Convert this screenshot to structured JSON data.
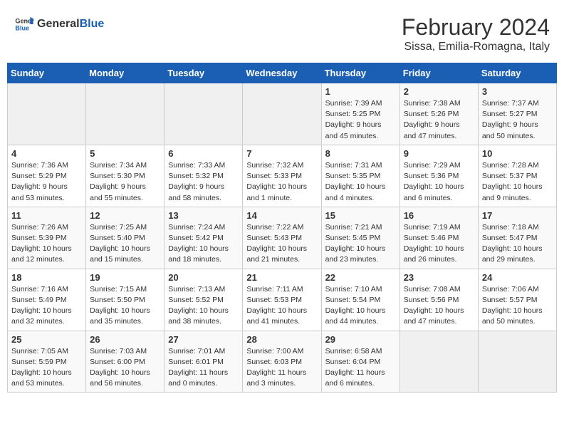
{
  "header": {
    "logo_general": "General",
    "logo_blue": "Blue",
    "title": "February 2024",
    "subtitle": "Sissa, Emilia-Romagna, Italy"
  },
  "weekdays": [
    "Sunday",
    "Monday",
    "Tuesday",
    "Wednesday",
    "Thursday",
    "Friday",
    "Saturday"
  ],
  "weeks": [
    [
      {
        "day": "",
        "info": ""
      },
      {
        "day": "",
        "info": ""
      },
      {
        "day": "",
        "info": ""
      },
      {
        "day": "",
        "info": ""
      },
      {
        "day": "1",
        "info": "Sunrise: 7:39 AM\nSunset: 5:25 PM\nDaylight: 9 hours\nand 45 minutes."
      },
      {
        "day": "2",
        "info": "Sunrise: 7:38 AM\nSunset: 5:26 PM\nDaylight: 9 hours\nand 47 minutes."
      },
      {
        "day": "3",
        "info": "Sunrise: 7:37 AM\nSunset: 5:27 PM\nDaylight: 9 hours\nand 50 minutes."
      }
    ],
    [
      {
        "day": "4",
        "info": "Sunrise: 7:36 AM\nSunset: 5:29 PM\nDaylight: 9 hours\nand 53 minutes."
      },
      {
        "day": "5",
        "info": "Sunrise: 7:34 AM\nSunset: 5:30 PM\nDaylight: 9 hours\nand 55 minutes."
      },
      {
        "day": "6",
        "info": "Sunrise: 7:33 AM\nSunset: 5:32 PM\nDaylight: 9 hours\nand 58 minutes."
      },
      {
        "day": "7",
        "info": "Sunrise: 7:32 AM\nSunset: 5:33 PM\nDaylight: 10 hours\nand 1 minute."
      },
      {
        "day": "8",
        "info": "Sunrise: 7:31 AM\nSunset: 5:35 PM\nDaylight: 10 hours\nand 4 minutes."
      },
      {
        "day": "9",
        "info": "Sunrise: 7:29 AM\nSunset: 5:36 PM\nDaylight: 10 hours\nand 6 minutes."
      },
      {
        "day": "10",
        "info": "Sunrise: 7:28 AM\nSunset: 5:37 PM\nDaylight: 10 hours\nand 9 minutes."
      }
    ],
    [
      {
        "day": "11",
        "info": "Sunrise: 7:26 AM\nSunset: 5:39 PM\nDaylight: 10 hours\nand 12 minutes."
      },
      {
        "day": "12",
        "info": "Sunrise: 7:25 AM\nSunset: 5:40 PM\nDaylight: 10 hours\nand 15 minutes."
      },
      {
        "day": "13",
        "info": "Sunrise: 7:24 AM\nSunset: 5:42 PM\nDaylight: 10 hours\nand 18 minutes."
      },
      {
        "day": "14",
        "info": "Sunrise: 7:22 AM\nSunset: 5:43 PM\nDaylight: 10 hours\nand 21 minutes."
      },
      {
        "day": "15",
        "info": "Sunrise: 7:21 AM\nSunset: 5:45 PM\nDaylight: 10 hours\nand 23 minutes."
      },
      {
        "day": "16",
        "info": "Sunrise: 7:19 AM\nSunset: 5:46 PM\nDaylight: 10 hours\nand 26 minutes."
      },
      {
        "day": "17",
        "info": "Sunrise: 7:18 AM\nSunset: 5:47 PM\nDaylight: 10 hours\nand 29 minutes."
      }
    ],
    [
      {
        "day": "18",
        "info": "Sunrise: 7:16 AM\nSunset: 5:49 PM\nDaylight: 10 hours\nand 32 minutes."
      },
      {
        "day": "19",
        "info": "Sunrise: 7:15 AM\nSunset: 5:50 PM\nDaylight: 10 hours\nand 35 minutes."
      },
      {
        "day": "20",
        "info": "Sunrise: 7:13 AM\nSunset: 5:52 PM\nDaylight: 10 hours\nand 38 minutes."
      },
      {
        "day": "21",
        "info": "Sunrise: 7:11 AM\nSunset: 5:53 PM\nDaylight: 10 hours\nand 41 minutes."
      },
      {
        "day": "22",
        "info": "Sunrise: 7:10 AM\nSunset: 5:54 PM\nDaylight: 10 hours\nand 44 minutes."
      },
      {
        "day": "23",
        "info": "Sunrise: 7:08 AM\nSunset: 5:56 PM\nDaylight: 10 hours\nand 47 minutes."
      },
      {
        "day": "24",
        "info": "Sunrise: 7:06 AM\nSunset: 5:57 PM\nDaylight: 10 hours\nand 50 minutes."
      }
    ],
    [
      {
        "day": "25",
        "info": "Sunrise: 7:05 AM\nSunset: 5:59 PM\nDaylight: 10 hours\nand 53 minutes."
      },
      {
        "day": "26",
        "info": "Sunrise: 7:03 AM\nSunset: 6:00 PM\nDaylight: 10 hours\nand 56 minutes."
      },
      {
        "day": "27",
        "info": "Sunrise: 7:01 AM\nSunset: 6:01 PM\nDaylight: 11 hours\nand 0 minutes."
      },
      {
        "day": "28",
        "info": "Sunrise: 7:00 AM\nSunset: 6:03 PM\nDaylight: 11 hours\nand 3 minutes."
      },
      {
        "day": "29",
        "info": "Sunrise: 6:58 AM\nSunset: 6:04 PM\nDaylight: 11 hours\nand 6 minutes."
      },
      {
        "day": "",
        "info": ""
      },
      {
        "day": "",
        "info": ""
      }
    ]
  ]
}
